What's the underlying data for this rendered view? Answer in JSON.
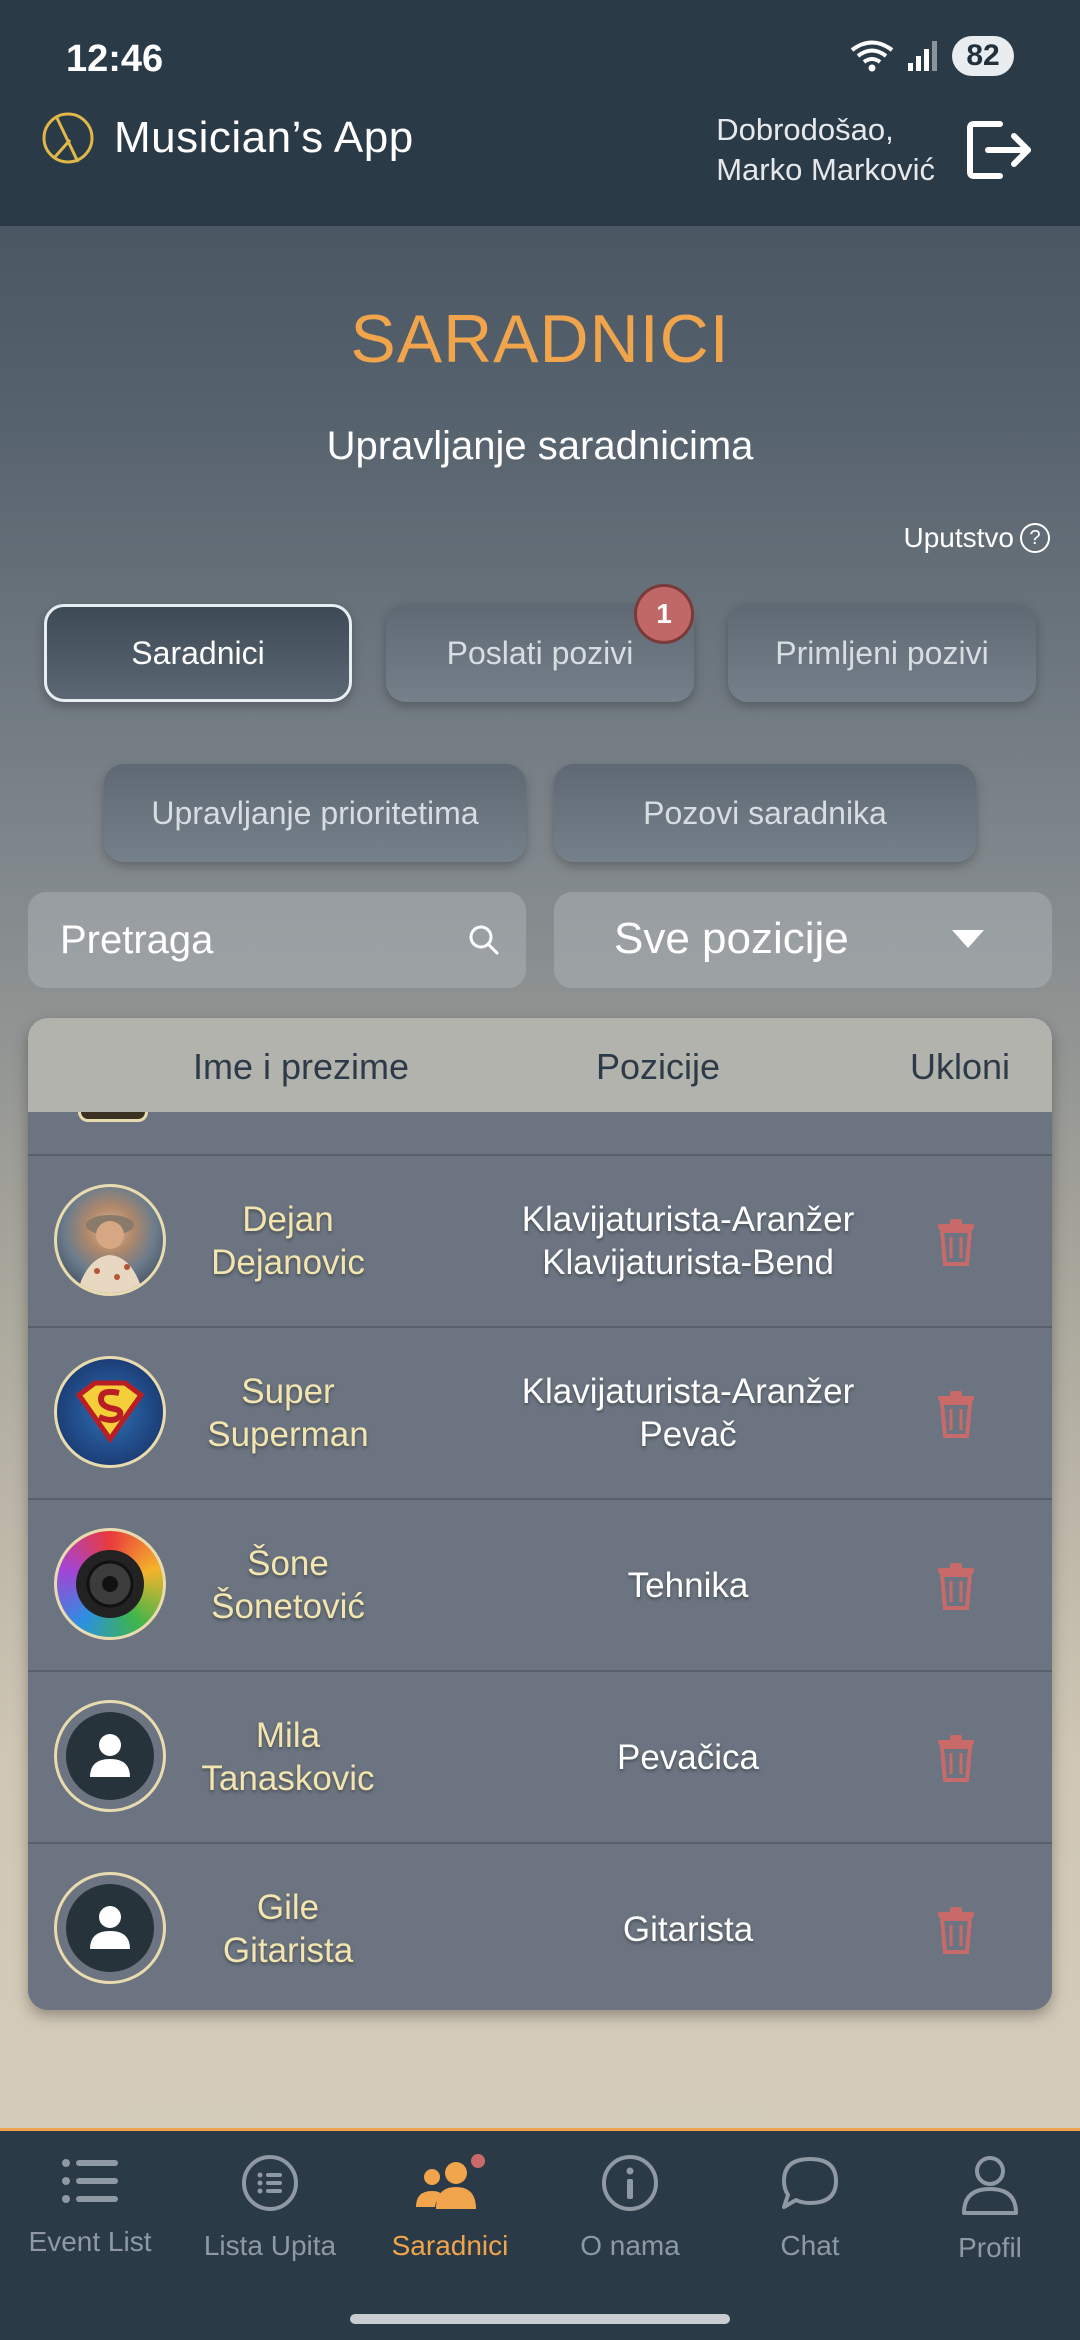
{
  "status_bar": {
    "time": "12:46",
    "battery": "82"
  },
  "header": {
    "app_title": "Musician’s App",
    "welcome_line1": "Dobrodošao,",
    "welcome_line2": "Marko Marković"
  },
  "page": {
    "title": "SARADNICI",
    "subtitle": "Upravljanje saradnicima",
    "help_label": "Uputstvo"
  },
  "tabs": [
    {
      "label": "Saradnici",
      "active": true
    },
    {
      "label": "Poslati pozivi",
      "badge": "1"
    },
    {
      "label": "Primljeni pozivi"
    },
    {
      "label": "Upravljanje prioritetima"
    },
    {
      "label": "Pozovi saradnika"
    }
  ],
  "filters": {
    "search_placeholder": "Pretraga",
    "position_select": "Sve pozicije"
  },
  "table": {
    "headers": {
      "name": "Ime i prezime",
      "positions": "Pozicije",
      "remove": "Ukloni"
    },
    "rows": [
      {
        "first": "Dejan",
        "last": "Dejanovic",
        "positions": [
          "Klavijaturista-Aranžer",
          "Klavijaturista-Bend"
        ],
        "avatar": "photo-avatar"
      },
      {
        "first": "Super",
        "last": "Superman",
        "positions": [
          "Klavijaturista-Aranžer",
          "Pevač"
        ],
        "avatar": "superman-avatar"
      },
      {
        "first": "Šone",
        "last": "Šonetović",
        "positions": [
          "Tehnika"
        ],
        "avatar": "speaker-avatar"
      },
      {
        "first": "Mila",
        "last": "Tanaskovic",
        "positions": [
          "Pevačica"
        ],
        "avatar": "default-user-avatar"
      },
      {
        "first": "Gile",
        "last": "Gitarista",
        "positions": [
          "Gitarista"
        ],
        "avatar": "default-user-avatar"
      }
    ]
  },
  "bottom_nav": [
    {
      "label": "Event List",
      "icon": "list-icon"
    },
    {
      "label": "Lista Upita",
      "icon": "circle-list-icon"
    },
    {
      "label": "Saradnici",
      "icon": "people-icon",
      "active": true
    },
    {
      "label": "O nama",
      "icon": "info-icon"
    },
    {
      "label": "Chat",
      "icon": "chat-icon"
    },
    {
      "label": "Profil",
      "icon": "profile-icon"
    }
  ],
  "colors": {
    "accent": "#f0a44b",
    "header_bg": "#2b3a47",
    "danger": "#c96a6a",
    "name_text": "#f2e5b0"
  }
}
